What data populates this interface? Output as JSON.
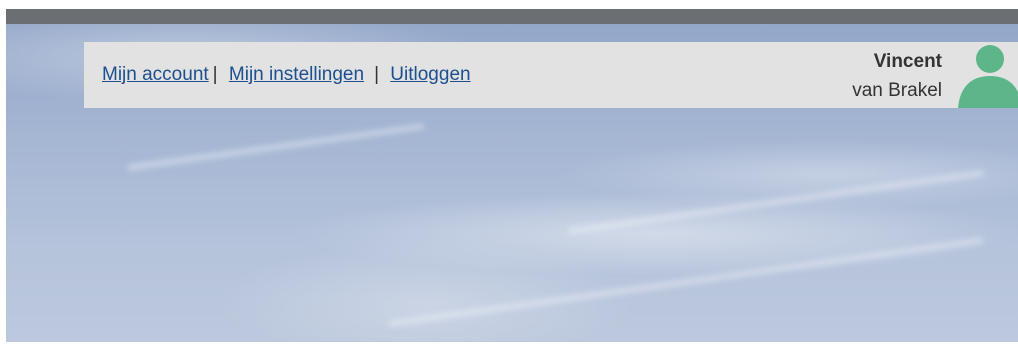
{
  "user_bar": {
    "links": [
      {
        "label": "Mijn account"
      },
      {
        "label": "Mijn instellingen"
      },
      {
        "label": "Uitloggen"
      }
    ],
    "separator": "|",
    "user": {
      "first_name": "Vincent",
      "last_name": "van Brakel",
      "avatar_icon": "user-avatar-icon",
      "avatar_color": "#5db58a"
    }
  },
  "colors": {
    "link": "#1c4f8f",
    "bar_background": "#e2e2e2",
    "top_strip": "#6b6e72"
  }
}
